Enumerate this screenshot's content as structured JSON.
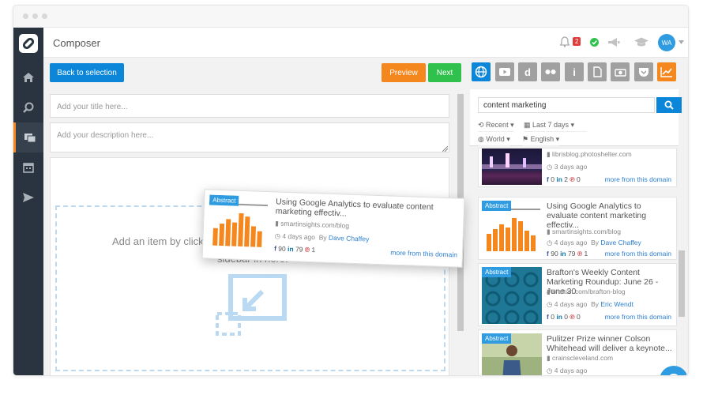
{
  "header": {
    "title": "Composer",
    "notifications": "2",
    "avatar": "WA"
  },
  "toolbar": {
    "back": "Back to selection",
    "preview": "Preview",
    "next": "Next"
  },
  "editor": {
    "title_placeholder": "Add your title here...",
    "desc_placeholder": "Add your description here...",
    "drop_text": "Add an item by click",
    "drop_text2": "sidebar in here."
  },
  "sources": [
    "globe",
    "youtube",
    "d",
    "flickr",
    "i",
    "doc",
    "camera",
    "pocket",
    "chart"
  ],
  "search": {
    "value": "content marketing"
  },
  "filters": {
    "sort": "Recent",
    "date": "Last 7 days",
    "region": "World",
    "language": "English"
  },
  "results": [
    {
      "title": "",
      "domain": "librisblog.photoshelter.com",
      "time": "3 days ago",
      "author": "",
      "fb": "0",
      "li": "2",
      "pin": "0",
      "more": "more from this domain",
      "thumb": "city",
      "abstract": ""
    },
    {
      "title": "Using Google Analytics to evaluate content marketing effectiv...",
      "domain": "smartinsights.com/blog",
      "time": "4 days ago",
      "author": "Dave Chaffey",
      "fb": "90",
      "li": "79",
      "pin": "1",
      "more": "more from this domain",
      "thumb": "chart",
      "abstract": "Abstract"
    },
    {
      "title": "Brafton's Weekly Content Marketing Roundup: June 26 - June 30",
      "domain": "brafton.com/brafton-blog",
      "time": "4 days ago",
      "author": "Eric Wendt",
      "fb": "0",
      "li": "0",
      "pin": "0",
      "more": "more from this domain",
      "thumb": "pattern",
      "abstract": "Abstract"
    },
    {
      "title": "Pulitzer Prize winner Colson Whitehead will deliver a keynote...",
      "domain": "crainscleveland.com",
      "time": "4 days ago",
      "author": "",
      "fb": "",
      "li": "",
      "pin": "",
      "more": "",
      "thumb": "person",
      "abstract": "Abstract"
    }
  ],
  "dragging": {
    "abstract": "Abstract",
    "title": "Using Google Analytics to evaluate content marketing effectiv...",
    "domain": "smartinsights.com/blog",
    "time": "4 days ago",
    "by": "By",
    "author": "Dave Chaffey",
    "fb": "90",
    "li": "79",
    "pin": "1",
    "more": "more from this domain"
  },
  "colors": {
    "sidebar": "#2a3440",
    "accent_blue": "#0b86d8",
    "orange": "#f5871f",
    "green": "#2fc14c"
  }
}
